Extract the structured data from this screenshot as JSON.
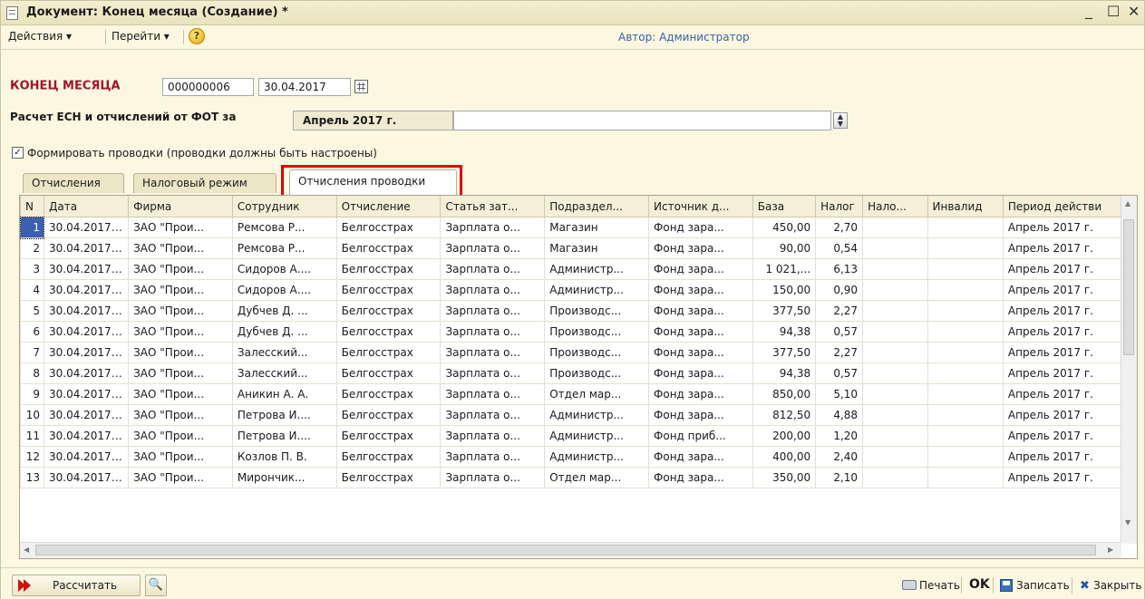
{
  "window": {
    "title": "Документ: Конец месяца (Создание) *",
    "controls": {
      "minimize": "_",
      "maximize": "☐",
      "close": "✕"
    }
  },
  "menu": {
    "actions": "Действия ▾",
    "goto": "Перейти ▾",
    "help": "?",
    "author": "Автор: Администратор"
  },
  "header": {
    "doc_label": "КОНЕЦ МЕСЯЦА",
    "number": "000000006",
    "date": "30.04.2017",
    "calc_label": "Расчет ЕСН и отчислений от ФОТ за",
    "period": "Апрель 2017 г.",
    "period_extra": "",
    "checkbox_mark": "✓",
    "checkbox_label": "Формировать проводки (проводки должны быть настроены)"
  },
  "tabs": [
    {
      "label": "Отчисления",
      "active": false
    },
    {
      "label": "Налоговый режим",
      "active": false
    },
    {
      "label": "Отчисления проводки",
      "active": true
    }
  ],
  "table": {
    "columns": [
      "N",
      "Дата",
      "Фирма",
      "Сотрудник",
      "Отчисление",
      "Статья зат...",
      "Подраздел...",
      "Источник д...",
      "База",
      "Налог",
      "Нало...",
      "Инвалид",
      "Период действи"
    ],
    "rows": [
      [
        "1",
        "30.04.2017 ...",
        "ЗАО \"Прои...",
        "Ремсова Р...",
        "Белгосстрах",
        "Зарплата о...",
        "Магазин",
        "Фонд зара...",
        "450,00",
        "2,70",
        "",
        "",
        "Апрель 2017 г."
      ],
      [
        "2",
        "30.04.2017 ...",
        "ЗАО \"Прои...",
        "Ремсова Р...",
        "Белгосстрах",
        "Зарплата о...",
        "Магазин",
        "Фонд зара...",
        "90,00",
        "0,54",
        "",
        "",
        "Апрель 2017 г."
      ],
      [
        "3",
        "30.04.2017 ...",
        "ЗАО \"Прои...",
        "Сидоров А....",
        "Белгосстрах",
        "Зарплата о...",
        "Администр...",
        "Фонд зара...",
        "1 021,...",
        "6,13",
        "",
        "",
        "Апрель 2017 г."
      ],
      [
        "4",
        "30.04.2017 ...",
        "ЗАО \"Прои...",
        "Сидоров А....",
        "Белгосстрах",
        "Зарплата о...",
        "Администр...",
        "Фонд зара...",
        "150,00",
        "0,90",
        "",
        "",
        "Апрель 2017 г."
      ],
      [
        "5",
        "30.04.2017 ...",
        "ЗАО \"Прои...",
        "Дубчев Д. ...",
        "Белгосстрах",
        "Зарплата о...",
        "Производс...",
        "Фонд зара...",
        "377,50",
        "2,27",
        "",
        "",
        "Апрель 2017 г."
      ],
      [
        "6",
        "30.04.2017 ...",
        "ЗАО \"Прои...",
        "Дубчев Д. ...",
        "Белгосстрах",
        "Зарплата о...",
        "Производс...",
        "Фонд зара...",
        "94,38",
        "0,57",
        "",
        "",
        "Апрель 2017 г."
      ],
      [
        "7",
        "30.04.2017 ...",
        "ЗАО \"Прои...",
        "Залесский...",
        "Белгосстрах",
        "Зарплата о...",
        "Производс...",
        "Фонд зара...",
        "377,50",
        "2,27",
        "",
        "",
        "Апрель 2017 г."
      ],
      [
        "8",
        "30.04.2017 ...",
        "ЗАО \"Прои...",
        "Залесский...",
        "Белгосстрах",
        "Зарплата о...",
        "Производс...",
        "Фонд зара...",
        "94,38",
        "0,57",
        "",
        "",
        "Апрель 2017 г."
      ],
      [
        "9",
        "30.04.2017 ...",
        "ЗАО \"Прои...",
        "Аникин А. А.",
        "Белгосстрах",
        "Зарплата о...",
        "Отдел мар...",
        "Фонд зара...",
        "850,00",
        "5,10",
        "",
        "",
        "Апрель 2017 г."
      ],
      [
        "10",
        "30.04.2017 ...",
        "ЗАО \"Прои...",
        "Петрова И....",
        "Белгосстрах",
        "Зарплата о...",
        "Администр...",
        "Фонд зара...",
        "812,50",
        "4,88",
        "",
        "",
        "Апрель 2017 г."
      ],
      [
        "11",
        "30.04.2017 ...",
        "ЗАО \"Прои...",
        "Петрова И....",
        "Белгосстрах",
        "Зарплата о...",
        "Администр...",
        "Фонд приб...",
        "200,00",
        "1,20",
        "",
        "",
        "Апрель 2017 г."
      ],
      [
        "12",
        "30.04.2017 ...",
        "ЗАО \"Прои...",
        "Козлов П. В.",
        "Белгосстрах",
        "Зарплата о...",
        "Администр...",
        "Фонд зара...",
        "400,00",
        "2,40",
        "",
        "",
        "Апрель 2017 г."
      ],
      [
        "13",
        "30.04.2017 ...",
        "ЗАО \"Прои...",
        "Мирончик...",
        "Белгосстрах",
        "Зарплата о...",
        "Отдел мар...",
        "Фонд зара...",
        "350,00",
        "2,10",
        "",
        "",
        "Апрель 2017 г."
      ]
    ]
  },
  "toolbar": {
    "calculate": "Рассчитать",
    "search_icon": "🔍",
    "print": "Печать",
    "ok": "OK",
    "save": "Записать",
    "close": "Закрыть",
    "close_mark": "✖"
  },
  "colors": {
    "doc_label": "#a0152a",
    "author": "#3b5fa6",
    "highlight": "#e00000",
    "selection": "#3c5fb0"
  }
}
